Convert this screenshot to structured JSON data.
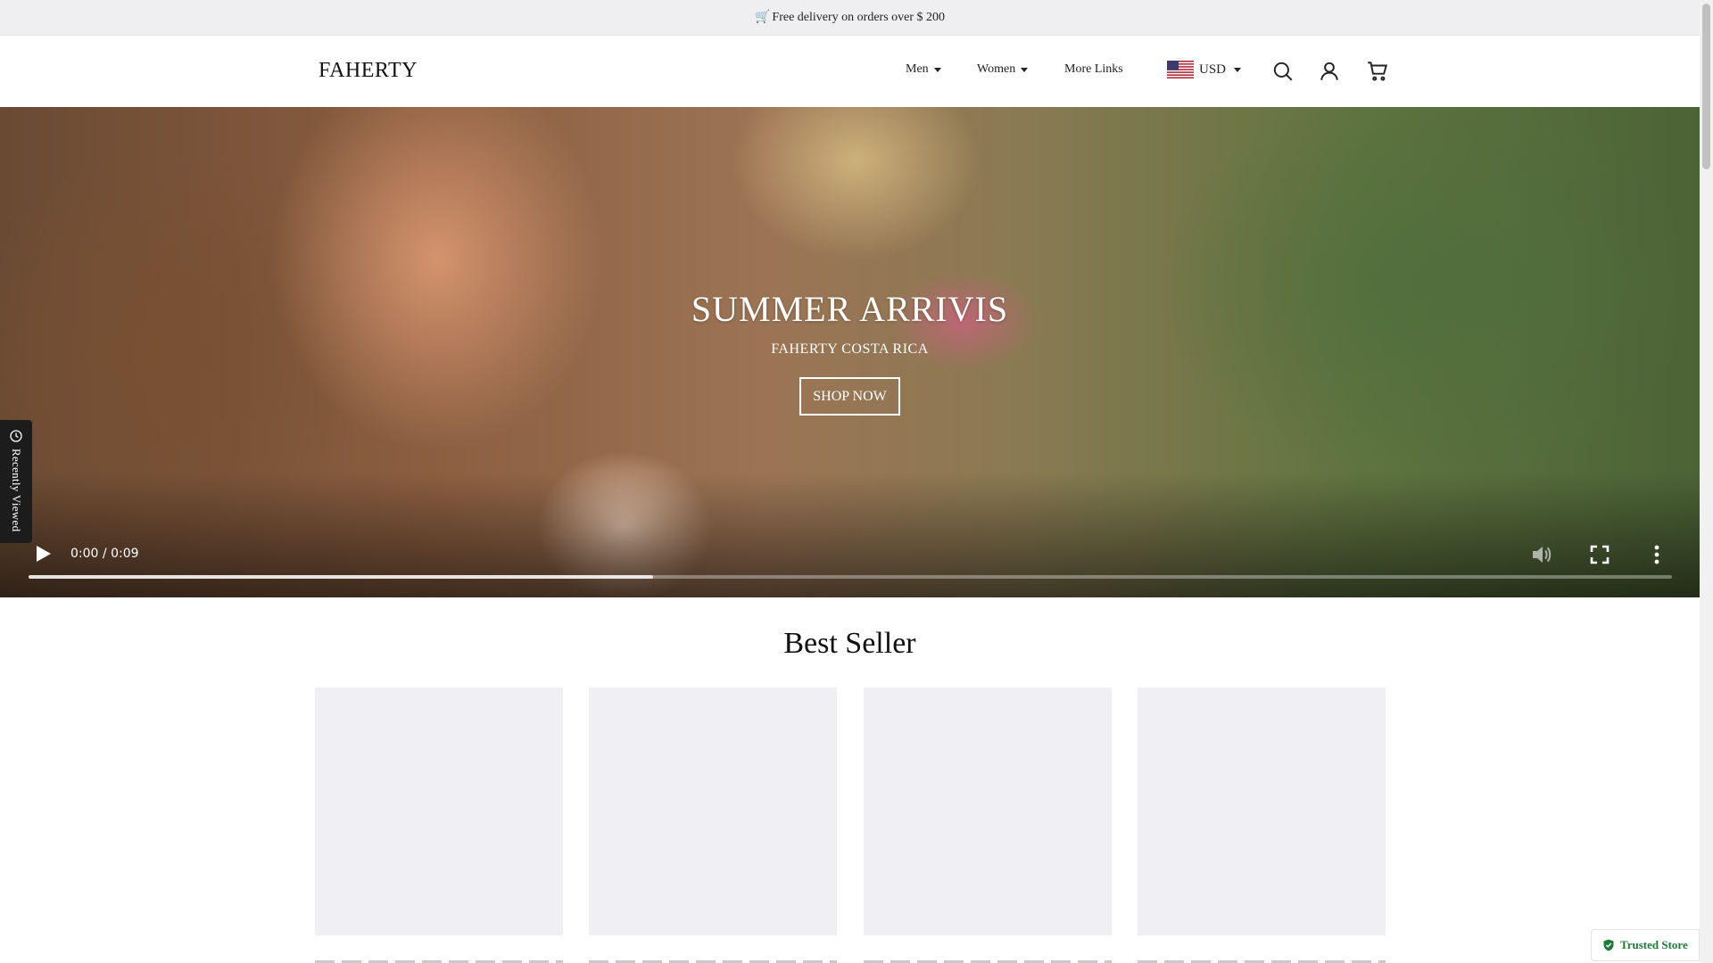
{
  "announcement": {
    "icon": "🛒",
    "text": "Free delivery on orders over $ 200"
  },
  "header": {
    "logo": "FAHERTY",
    "nav": [
      {
        "label": "Men",
        "has_dropdown": true
      },
      {
        "label": "Women",
        "has_dropdown": true
      },
      {
        "label": "More Links",
        "has_dropdown": false
      }
    ],
    "currency": {
      "code": "USD",
      "flag": "us-flag-icon"
    },
    "icons": [
      "search-icon",
      "user-account-icon",
      "cart-icon"
    ]
  },
  "hero": {
    "title": "SUMMER ARRIVIS",
    "subtitle": "FAHERTY COSTA RICA",
    "button_label": "SHOP NOW",
    "video": {
      "current_time": "0:00",
      "separator": "/",
      "duration": "0:09",
      "buffered_fraction": 0.38
    }
  },
  "recently_viewed": {
    "label": "Recently Viewed"
  },
  "best_seller": {
    "title": "Best Seller",
    "card_count": 4
  },
  "trust_badge": {
    "label": "Trusted Store",
    "color": "#1e7a3a"
  },
  "colors": {
    "hero_text": "#ffffff",
    "placeholder": "#efeff4",
    "announce_bg": "#efeff1"
  }
}
